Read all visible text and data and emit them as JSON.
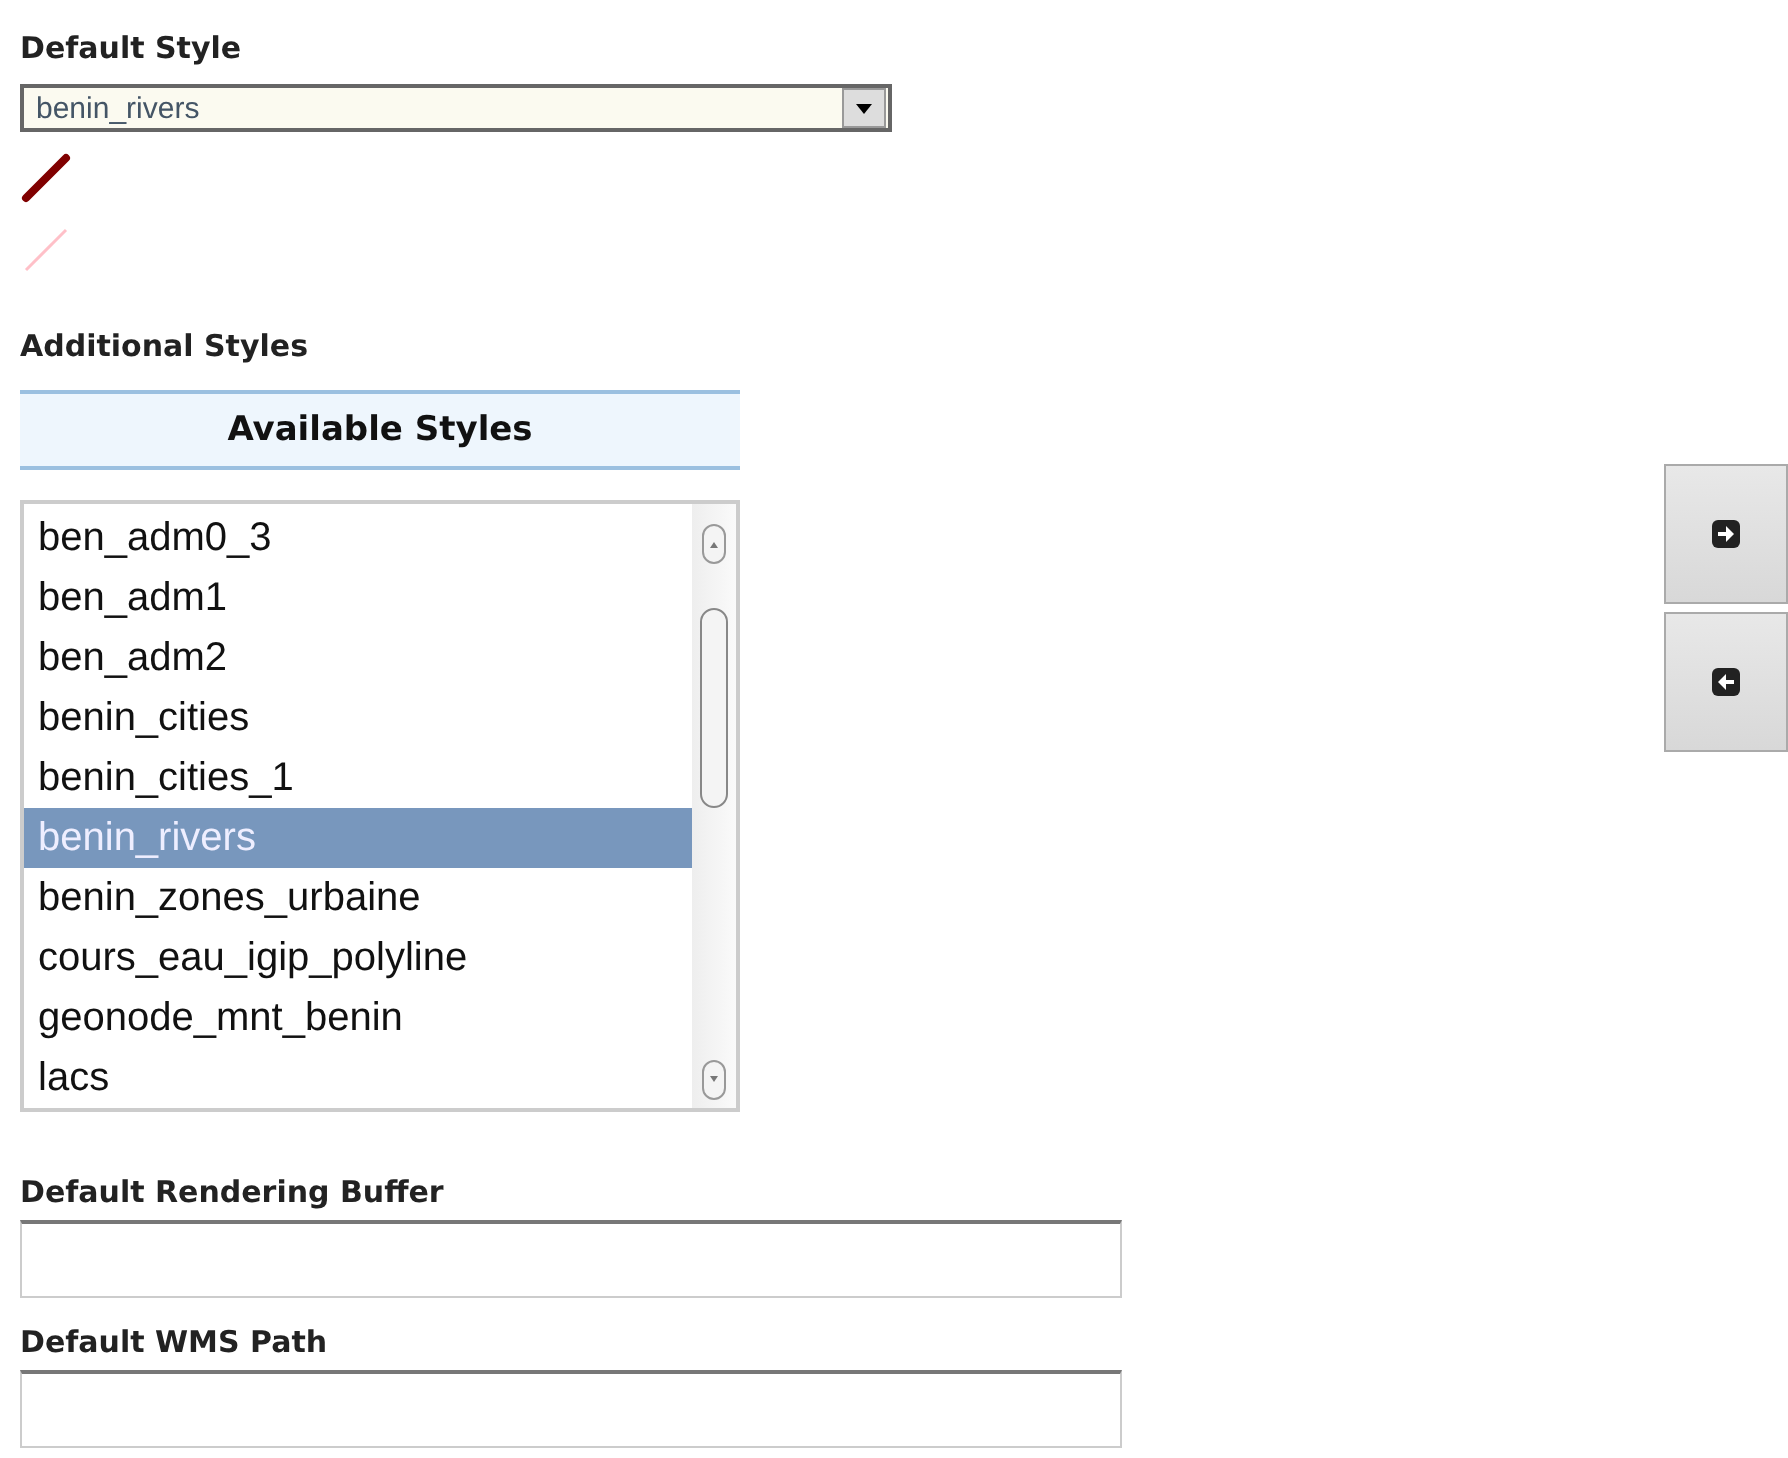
{
  "default_style": {
    "label": "Default Style",
    "value": "benin_rivers"
  },
  "additional_styles": {
    "label": "Additional Styles",
    "header": "Available Styles",
    "items": [
      {
        "label": "ben_adm0_3",
        "selected": false
      },
      {
        "label": "ben_adm1",
        "selected": false
      },
      {
        "label": "ben_adm2",
        "selected": false
      },
      {
        "label": "benin_cities",
        "selected": false
      },
      {
        "label": "benin_cities_1",
        "selected": false
      },
      {
        "label": "benin_rivers",
        "selected": true
      },
      {
        "label": "benin_zones_urbaine",
        "selected": false
      },
      {
        "label": "cours_eau_igip_polyline",
        "selected": false
      },
      {
        "label": "geonode_mnt_benin",
        "selected": false
      },
      {
        "label": "lacs",
        "selected": false
      }
    ]
  },
  "fields": [
    {
      "label": "Default Rendering Buffer"
    },
    {
      "label": "Default WMS Path"
    }
  ]
}
